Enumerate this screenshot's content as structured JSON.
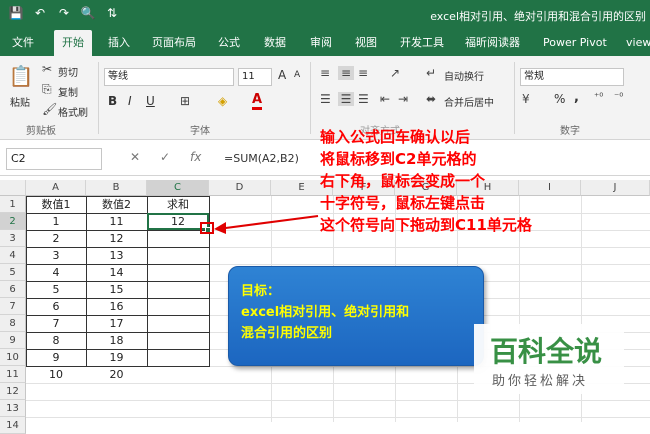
{
  "window": {
    "title": "excel相对引用、绝对引用和混合引用的区别"
  },
  "qat": {
    "save_icon": "💾",
    "undo_icon": "↶",
    "redo_icon": "↷",
    "preview_icon": "🔍",
    "sort_icon": "⇅"
  },
  "tabs": [
    "文件",
    "开始",
    "插入",
    "页面布局",
    "公式",
    "数据",
    "审阅",
    "视图",
    "开发工具",
    "福昕阅读器",
    "Power Pivot",
    "view"
  ],
  "ribbon": {
    "clipboard": {
      "paste": "粘贴",
      "cut": "剪切",
      "copy": "复制",
      "format_painter": "格式刷",
      "group": "剪贴板"
    },
    "font": {
      "name": "等线",
      "size": "11",
      "bold": "B",
      "italic": "I",
      "underline": "U",
      "font_color_label": "A",
      "group": "字体",
      "grow": "A",
      "shrink": "A"
    },
    "alignment": {
      "wrap": "自动换行",
      "merge": "合并后居中",
      "group": "对齐方式"
    },
    "number": {
      "format": "常规",
      "percent": "%",
      "comma": ",",
      "group": "数字"
    }
  },
  "formula_bar": {
    "name_box": "C2",
    "cancel": "✕",
    "confirm": "✓",
    "fx": "fx",
    "formula": "=SUM(A2,B2)"
  },
  "columns": [
    "A",
    "B",
    "C",
    "D",
    "E",
    "F",
    "G",
    "H",
    "I",
    "J"
  ],
  "rows": [
    "1",
    "2",
    "3",
    "4",
    "5",
    "6",
    "7",
    "8",
    "9",
    "10",
    "11",
    "12",
    "13",
    "14"
  ],
  "table": {
    "headers": [
      "数值1",
      "数值2",
      "求和"
    ],
    "col_a": [
      "1",
      "2",
      "3",
      "4",
      "5",
      "6",
      "7",
      "8",
      "9",
      "10"
    ],
    "col_b": [
      "11",
      "12",
      "13",
      "14",
      "15",
      "16",
      "17",
      "18",
      "19",
      "20"
    ],
    "c2": "12"
  },
  "annotation": {
    "lines": [
      "输入公式回车确认以后",
      "将鼠标移到C2单元格的",
      "右下角，鼠标会变成一个",
      "十字符号，鼠标左键点击",
      "这个符号向下拖动到C11单元格"
    ],
    "color": "#ff0000"
  },
  "target_box": {
    "lines": [
      "目标：",
      "excel相对引用、绝对引用和",
      "混合引用的区别"
    ]
  },
  "watermark": {
    "title": "百科全说",
    "subtitle": "助你轻松解决"
  },
  "colors": {
    "excel_green": "#217346",
    "arrow": "#e00000",
    "box_blue": "#2f83d4",
    "box_text": "#ffff00"
  }
}
